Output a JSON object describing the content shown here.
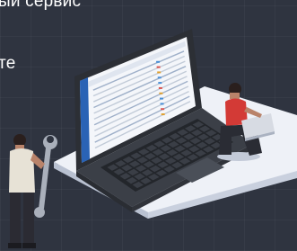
{
  "headline": {
    "line1": "ый сервис",
    "line2": "те"
  },
  "colors": {
    "background": "#2f3440",
    "platform_top": "#e9edf5",
    "platform_side": "#c9d0de",
    "laptop_body": "#3b3f47",
    "keyboard": "#23262b",
    "screen_bg": "#f4f6fa",
    "app_sidebar": "#2a63b5",
    "person_shirt": "#d33a36",
    "mechanic_jacket": "#e7e2d6",
    "mechanic_pants": "#2b2b33"
  },
  "icons": [
    "laptop-illustration",
    "person-with-laptop",
    "mechanic-with-wrench",
    "wrench-icon"
  ]
}
